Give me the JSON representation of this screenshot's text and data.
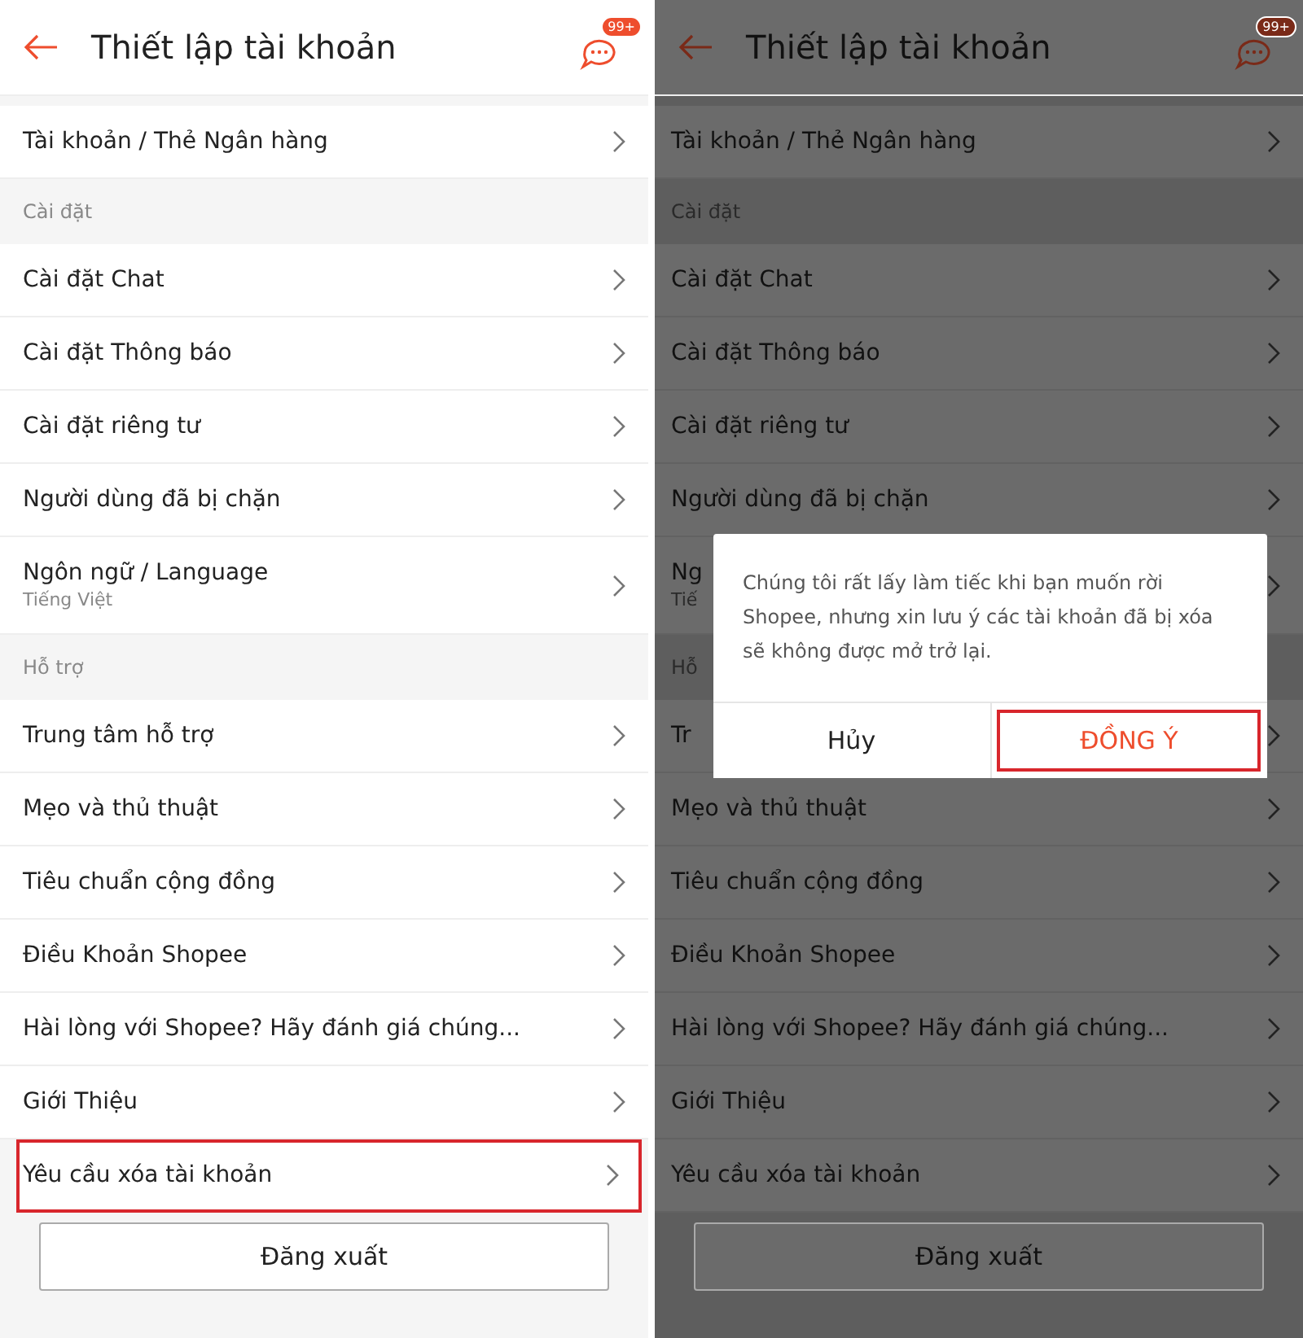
{
  "screens": [
    {
      "dimmed": false,
      "header": {
        "title": "Thiết lập tài khoản",
        "badge": "99+"
      },
      "sections": [
        {
          "items": [
            {
              "label": "Tài khoản / Thẻ Ngân hàng",
              "highlighted": false
            }
          ]
        },
        {
          "title": "Cài đặt",
          "items": [
            {
              "label": "Cài đặt Chat",
              "highlighted": false
            },
            {
              "label": "Cài đặt Thông báo",
              "highlighted": false
            },
            {
              "label": "Cài đặt riêng tư",
              "highlighted": false
            },
            {
              "label": "Người dùng đã bị chặn",
              "highlighted": false
            },
            {
              "label": "Ngôn ngữ / Language",
              "sublabel": "Tiếng Việt",
              "highlighted": false
            }
          ]
        },
        {
          "title": "Hỗ trợ",
          "items": [
            {
              "label": "Trung tâm hỗ trợ",
              "highlighted": false
            },
            {
              "label": "Mẹo và thủ thuật",
              "highlighted": false
            },
            {
              "label": "Tiêu chuẩn cộng đồng",
              "highlighted": false
            },
            {
              "label": "Điều Khoản Shopee",
              "highlighted": false
            },
            {
              "label": "Hài lòng với Shopee? Hãy đánh giá chúng...",
              "highlighted": false
            },
            {
              "label": "Giới Thiệu",
              "highlighted": false
            },
            {
              "label": "Yêu cầu xóa tài khoản",
              "highlighted": true
            }
          ]
        }
      ],
      "logout": "Đăng xuất"
    },
    {
      "dimmed": true,
      "header": {
        "title": "Thiết lập tài khoản",
        "badge": "99+"
      },
      "sections": [
        {
          "items": [
            {
              "label": "Tài khoản / Thẻ Ngân hàng",
              "highlighted": false
            }
          ]
        },
        {
          "title": "Cài đặt",
          "items": [
            {
              "label": "Cài đặt Chat",
              "highlighted": false
            },
            {
              "label": "Cài đặt Thông báo",
              "highlighted": false
            },
            {
              "label": "Cài đặt riêng tư",
              "highlighted": false
            },
            {
              "label": "Người dùng đã bị chặn",
              "highlighted": false
            },
            {
              "label": "Ng",
              "sublabel": "Tiế",
              "highlighted": false
            }
          ]
        },
        {
          "title": "Hỗ",
          "items": [
            {
              "label": "Tr",
              "highlighted": false
            },
            {
              "label": "Mẹo và thủ thuật",
              "highlighted": false
            },
            {
              "label": "Tiêu chuẩn cộng đồng",
              "highlighted": false
            },
            {
              "label": "Điều Khoản Shopee",
              "highlighted": false
            },
            {
              "label": "Hài lòng với Shopee? Hãy đánh giá chúng...",
              "highlighted": false
            },
            {
              "label": "Giới Thiệu",
              "highlighted": false
            },
            {
              "label": "Yêu cầu xóa tài khoản",
              "highlighted": false
            }
          ]
        }
      ],
      "logout": "Đăng xuất",
      "dialog": {
        "message": "Chúng tôi rất lấy làm tiếc khi bạn muốn rời Shopee, nhưng xin lưu ý các tài khoản đã bị xóa sẽ không được mở trở lại.",
        "buttons": [
          {
            "label": "Hủy",
            "kind": "cancel",
            "highlighted": false
          },
          {
            "label": "ĐỒNG Ý",
            "kind": "confirm",
            "highlighted": true
          }
        ]
      }
    }
  ]
}
